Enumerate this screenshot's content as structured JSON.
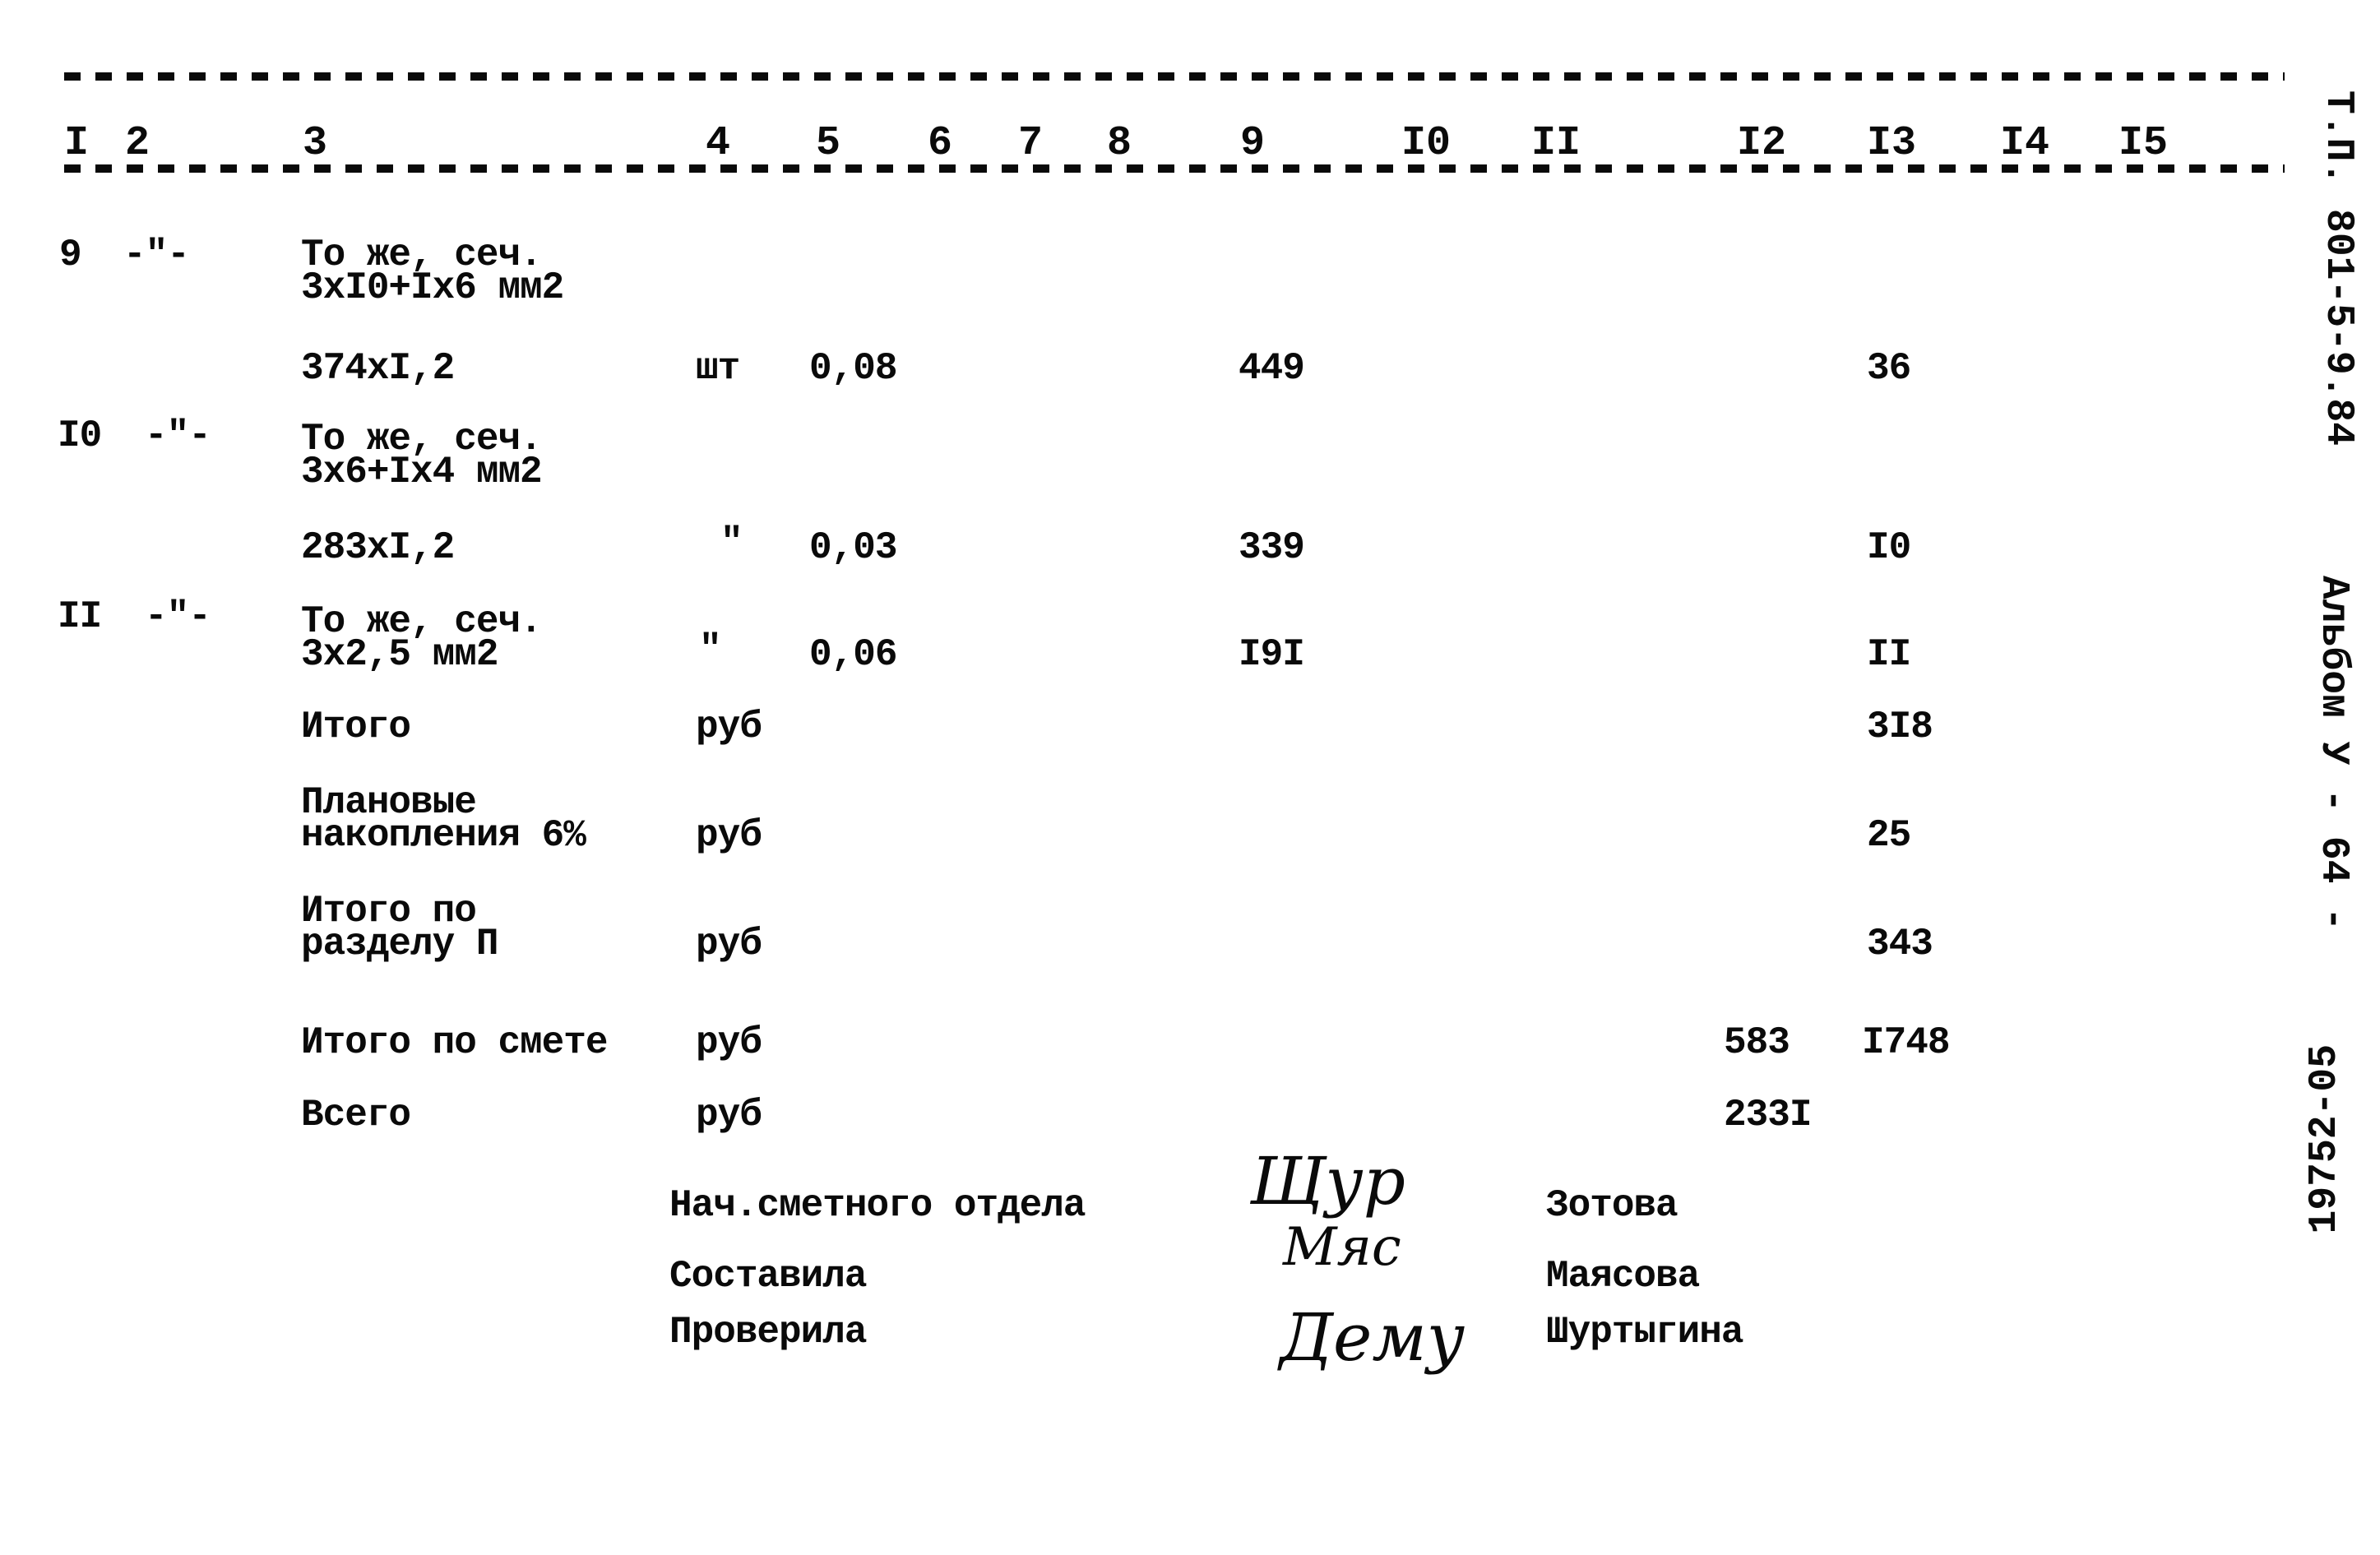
{
  "header": {
    "column_numbers": [
      "I",
      "2",
      "3",
      "4",
      "5",
      "6",
      "7",
      "8",
      "9",
      "I0",
      "II",
      "I2",
      "I3",
      "I4",
      "I5"
    ]
  },
  "rows": [
    {
      "col1": "9",
      "col2": "-\"-",
      "col3": "То же, сеч.\n3хI0+Iх6 мм2",
      "col4": "",
      "col5": "",
      "col9": "",
      "col12": "",
      "col13": ""
    },
    {
      "col1": "",
      "col2": "",
      "col3": "374хI,2",
      "col4": "шт",
      "col5": "0,08",
      "col9": "449",
      "col12": "",
      "col13": "36"
    },
    {
      "col1": "I0",
      "col2": "-\"-",
      "col3": "То же, сеч.\n3х6+Iх4 мм2",
      "col4": "",
      "col5": "",
      "col9": "",
      "col12": "",
      "col13": ""
    },
    {
      "col1": "",
      "col2": "",
      "col3": "283хI,2",
      "col4": "\"",
      "col5": "0,03",
      "col9": "339",
      "col12": "",
      "col13": "I0"
    },
    {
      "col1": "II",
      "col2": "-\"-",
      "col3": "То же, сеч.\n3х2,5 мм2",
      "col4": "\"",
      "col5": "0,06",
      "col9": "I9I",
      "col12": "",
      "col13": "II"
    },
    {
      "col1": "",
      "col2": "",
      "col3": "Итого",
      "col4": "руб",
      "col5": "",
      "col9": "",
      "col12": "",
      "col13": "3I8"
    },
    {
      "col1": "",
      "col2": "",
      "col3": "Плановые\nнакопления 6%",
      "col4": "руб",
      "col5": "",
      "col9": "",
      "col12": "",
      "col13": "25"
    },
    {
      "col1": "",
      "col2": "",
      "col3": "Итого по\nразделу П",
      "col4": "руб",
      "col5": "",
      "col9": "",
      "col12": "",
      "col13": "343"
    },
    {
      "col1": "",
      "col2": "",
      "col3": "Итого по смете",
      "col4": "руб",
      "col5": "",
      "col9": "",
      "col12": "583",
      "col13": "I748"
    },
    {
      "col1": "",
      "col2": "",
      "col3": "Всего",
      "col4": "руб",
      "col5": "",
      "col9": "",
      "col12": "233I",
      "col13": ""
    }
  ],
  "signatures": [
    {
      "role": "Нач.сметного отдела",
      "signature": "Щур",
      "name": "Зотова"
    },
    {
      "role": "Составила",
      "signature": "Мяс",
      "name": "Маясова"
    },
    {
      "role": "Проверила",
      "signature": "Дему",
      "name": "Шуртыгина"
    }
  ],
  "margin": {
    "code": "Т.П. 801-5-9.84",
    "album": "Альбом У - 64 -",
    "number": "19752-05"
  }
}
